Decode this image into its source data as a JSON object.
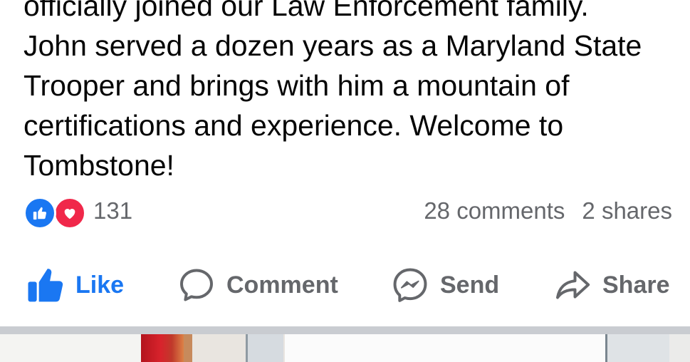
{
  "post": {
    "text_lines": [
      "officially joined our Law Enforcement family.",
      "John served a dozen years as a Maryland State",
      "Trooper and brings with him a mountain of",
      "certifications and experience. Welcome to",
      "Tombstone!"
    ]
  },
  "stats": {
    "reaction_count": "131",
    "reactions": [
      "like-reaction",
      "love-reaction"
    ],
    "comments": "28 comments",
    "shares": "2 shares"
  },
  "actions": {
    "like": "Like",
    "comment": "Comment",
    "send": "Send",
    "share": "Share"
  },
  "colors": {
    "accent": "#1a77f2",
    "love": "#f0284a",
    "secondary_text": "#65676b",
    "separator": "#c9ccd1"
  }
}
